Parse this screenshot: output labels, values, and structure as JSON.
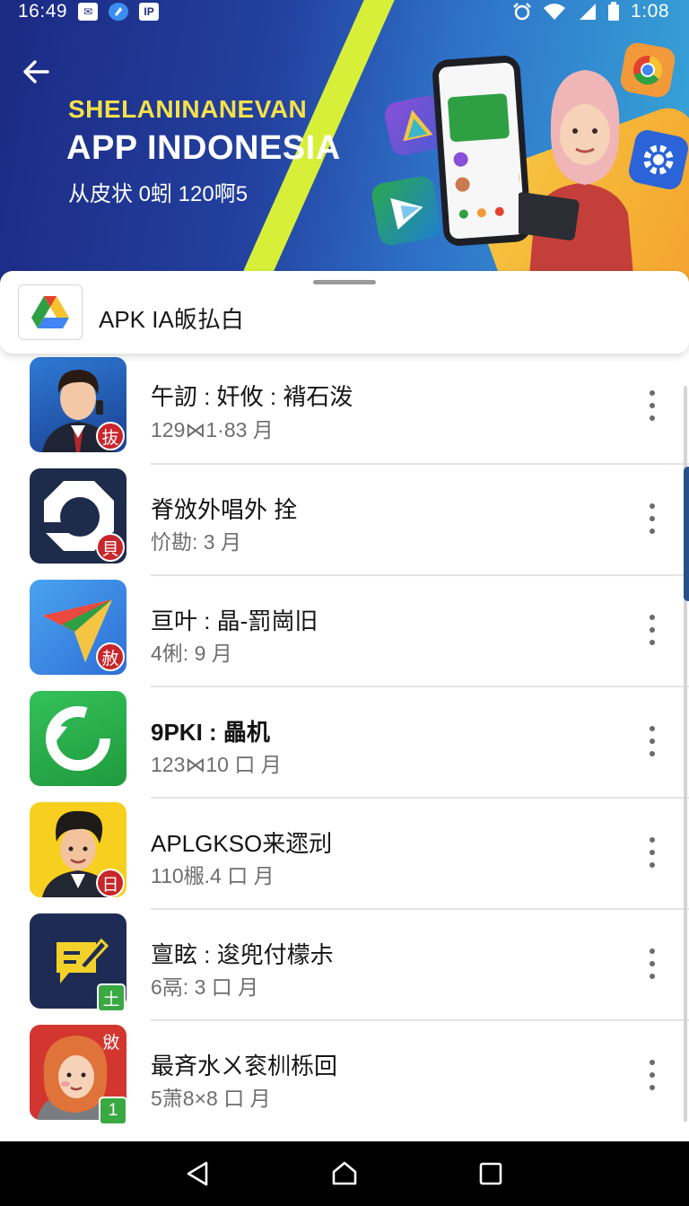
{
  "status_bar": {
    "time_left": "16:49",
    "icon_badge_1": "✉",
    "icon_badge_3": "IP",
    "time_right": "1:08"
  },
  "hero": {
    "kicker": "SHELANINANEVAN",
    "title": "APP INDONESIA",
    "subtitle": "从皮状 0蚓  120啊5"
  },
  "title_card": {
    "title": "APK IA皈払白"
  },
  "apps": [
    {
      "name": "午訒 : 奸攸 : 褙石泼",
      "meta": "129⋈1·83 月",
      "badge": "抜",
      "badge_style": "round",
      "icon": "person-businessman-icon"
    },
    {
      "name": "脊攽外唱外  拴",
      "meta": "忦勘: 3 月",
      "badge": "貝",
      "badge_style": "round",
      "icon": "octagon-logo-icon"
    },
    {
      "name": "亘叶 : 晶-罰崗旧",
      "meta": "4俐: 9 月",
      "badge": "赦",
      "badge_style": "round",
      "icon": "paper-plane-icon"
    },
    {
      "name": "9PKI : 畾机",
      "meta": "123⋈10 口 月",
      "badge": "",
      "badge_style": "none",
      "icon": "refresh-arrow-icon"
    },
    {
      "name": "APLGKSO来遝刓",
      "meta": "110棴.4 口 月",
      "badge": "日",
      "badge_style": "round",
      "icon": "person-young-man-icon"
    },
    {
      "name": "亶眩 : 逡兜付檬尗",
      "meta": "6鬲: 3 口 月",
      "badge": "土",
      "badge_style": "square",
      "icon": "note-pen-icon"
    },
    {
      "name": "最斉水ㄨ衮杊栎回",
      "meta": "5萧8×8 口 月",
      "badge": "1",
      "badge_style": "square",
      "icon": "person-woman-hijab-icon",
      "top_tag": "敓"
    }
  ],
  "colors": {
    "hero_start": "#1b2a83",
    "hero_end": "#37a7d8",
    "kicker": "#f4e14a",
    "badge_red": "#c8262b",
    "badge_green": "#3aa843"
  }
}
